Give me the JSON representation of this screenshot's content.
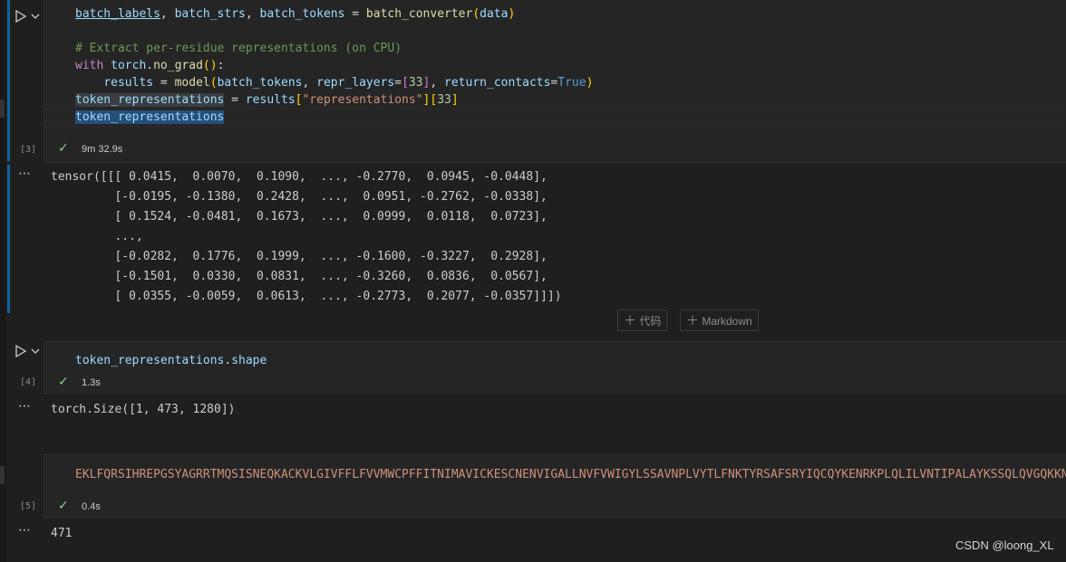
{
  "cell3": {
    "exec_count": "[3]",
    "time": "9m 32.9s",
    "lines": {
      "l1_a": "batch_labels",
      "l1_b": ", ",
      "l1_c": "batch_strs",
      "l1_d": ", ",
      "l1_e": "batch_tokens",
      "l1_f": " = ",
      "l1_g": "batch_converter",
      "l1_h": "(",
      "l1_i": "data",
      "l1_j": ")",
      "comment": "# Extract per-residue representations (on CPU)",
      "l3_kw": "with",
      "l3_mod": "torch",
      "l3_dot": ".",
      "l3_fn": "no_grad",
      "l3_p": "()",
      "l3_c": ":",
      "l4_var": "results",
      "l4_eq": " = ",
      "l4_fn": "model",
      "l4_p1": "(",
      "l4_a1": "batch_tokens",
      "l4_c1": ", ",
      "l4_k1": "repr_layers",
      "l4_eq1": "=",
      "l4_b1": "[",
      "l4_n1": "33",
      "l4_b2": "]",
      "l4_c2": ", ",
      "l4_k2": "return_contacts",
      "l4_eq2": "=",
      "l4_t": "True",
      "l4_p2": ")",
      "l5_var": "token_representations",
      "l5_eq": " = ",
      "l5_res": "results",
      "l5_b1": "[",
      "l5_s": "\"representations\"",
      "l5_b2": "][",
      "l5_n": "33",
      "l5_b3": "]",
      "l6_var": "token_representations"
    },
    "output_lines": [
      "tensor([[[ 0.0415,  0.0070,  0.1090,  ..., -0.2770,  0.0945, -0.0448],",
      "         [-0.0195, -0.1380,  0.2428,  ...,  0.0951, -0.2762, -0.0338],",
      "         [ 0.1524, -0.0481,  0.1673,  ...,  0.0999,  0.0118,  0.0723],",
      "         ...,",
      "         [-0.0282,  0.1776,  0.1999,  ..., -0.1600, -0.3227,  0.2928],",
      "         [-0.1501,  0.0330,  0.0831,  ..., -0.3260,  0.0836,  0.0567],",
      "         [ 0.0355, -0.0059,  0.0613,  ..., -0.2773,  0.2077, -0.0357]]])"
    ]
  },
  "add_cell": {
    "code_label": "代码",
    "markdown_label": "Markdown"
  },
  "cell4": {
    "exec_count": "[4]",
    "time": "1.3s",
    "code_var": "token_representations",
    "code_dot": ".",
    "code_attr": "shape",
    "output": "torch.Size([1, 473, 1280])"
  },
  "cell5": {
    "exec_count": "[5]",
    "time": "0.4s",
    "sequence": "EKLFQRSIHREPGSYAGRRTMQSISNEQKACKVLGIVFFLFVVMWCPFFITNIMAVICKESCNENVIGALLNVFVWIGYLSSAVNPLVYTLFNKTYRSAFSRYIQCQYKENRKPLQLILVNTIPALAYKSSQLQVGQKKNSQ",
    "output": "471"
  },
  "watermark": "CSDN @loong_XL",
  "icons": {
    "run": "run-triangle-icon",
    "chevron": "chevron-down-icon",
    "check": "check-icon",
    "more": "more-dots-icon",
    "plus": "plus-icon"
  }
}
